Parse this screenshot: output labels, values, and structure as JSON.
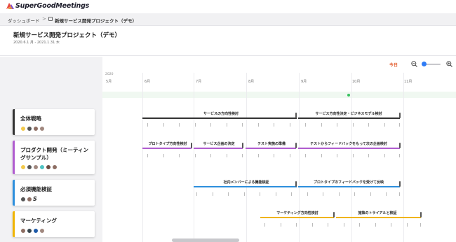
{
  "app": {
    "name": "SuperGoodMeetings"
  },
  "breadcrumb": {
    "home": "ダッシュボード",
    "separator": ">",
    "current": "新規サービス開発プロジェクト（デモ）"
  },
  "project": {
    "title": "新規サービス開発プロジェクト（デモ）",
    "dates": "2020.6.1 月 - 2021.1.31 木"
  },
  "toolbar": {
    "today_label": "今日",
    "zoom_level": 0.1
  },
  "timeline": {
    "year": "2020",
    "months": [
      "5月",
      "6月",
      "7月",
      "8月",
      "9月",
      "10月",
      "11月"
    ]
  },
  "groups": [
    {
      "name": "全体戦略",
      "color": "#333333",
      "avatars": [
        "#f2c94c",
        "#555555",
        "#8d6e63",
        "#a1887f"
      ]
    },
    {
      "name": "プロダクト開発（ミーティングサンプル）",
      "color": "#b05ccf",
      "avatars": [
        "#f2c94c",
        "#555555",
        "#a1887f",
        "#4fc3c3",
        "#6d4c41",
        "#8d6e63"
      ]
    },
    {
      "name": "必須機能検証",
      "color": "#2d8fdd",
      "avatars": [
        "#555555",
        "#8d6e63"
      ],
      "extra": "S"
    },
    {
      "name": "マーケティング",
      "color": "#f0b400",
      "avatars": [
        "#8d6e63",
        "#37474f",
        "#1e5aa8",
        "#a1887f"
      ]
    }
  ],
  "tasks": [
    {
      "label": "サービスの方向性検討",
      "color": "#333333"
    },
    {
      "label": "サービス方向性決定・ビジネスモデル検討",
      "color": "#333333"
    },
    {
      "label": "プロトタイプ方向性検討",
      "color": "#b05ccf"
    },
    {
      "label": "サービス企画の決定",
      "color": "#b05ccf"
    },
    {
      "label": "テスト実施の準備",
      "color": "#b05ccf"
    },
    {
      "label": "テストからフィードバックをもって次の企画検討",
      "color": "#b05ccf"
    },
    {
      "label": "社内メンバーによる機能検証",
      "color": "#2d8fdd"
    },
    {
      "label": "プロトタイプのフィードバックを受けて反映",
      "color": "#2d8fdd"
    },
    {
      "label": "マーケティング方向性検討",
      "color": "#f0b400"
    },
    {
      "label": "施策のトライアルと検証",
      "color": "#f0b400"
    }
  ]
}
